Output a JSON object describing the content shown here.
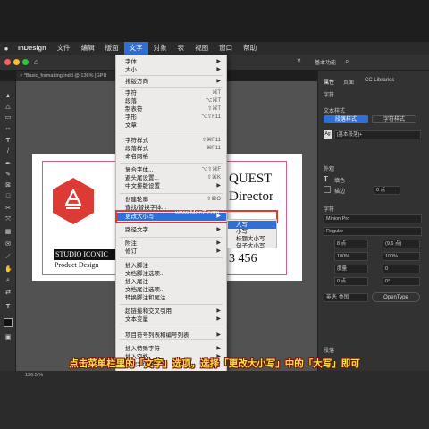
{
  "macbar": {
    "app_name": "InDesign",
    "menus": [
      "文件",
      "编辑",
      "版面",
      "文字",
      "对象",
      "表",
      "视图",
      "窗口",
      "帮助"
    ],
    "active_menu": "文字"
  },
  "doc_tab": "× *Basic_formatting.indd @ 136% [GPU",
  "workspace_label": "基本功能",
  "type_menu": {
    "items": [
      {
        "label": "字体",
        "shortcut": "",
        "submenu": true
      },
      {
        "label": "大小",
        "shortcut": "",
        "submenu": true
      },
      {
        "label": "排版方向",
        "shortcut": "",
        "submenu": true
      },
      {
        "label": "字符",
        "shortcut": "⌘T",
        "submenu": false
      },
      {
        "label": "段落",
        "shortcut": "⌥⌘T",
        "submenu": false
      },
      {
        "label": "制表符",
        "shortcut": "⇧⌘T",
        "submenu": false
      },
      {
        "label": "字形",
        "shortcut": "⌥⇧F11",
        "submenu": false
      },
      {
        "label": "文章",
        "shortcut": "",
        "submenu": false
      },
      {
        "label": "字符样式",
        "shortcut": "⇧⌘F11",
        "submenu": false
      },
      {
        "label": "段落样式",
        "shortcut": "⌘F11",
        "submenu": false
      },
      {
        "label": "命名网格",
        "shortcut": "",
        "submenu": false
      },
      {
        "label": "复合字体...",
        "shortcut": "⌥⇧⌘F",
        "submenu": false
      },
      {
        "label": "避头尾设置...",
        "shortcut": "⇧⌘K",
        "submenu": false
      },
      {
        "label": "中文排版设置",
        "shortcut": "",
        "submenu": true
      },
      {
        "label": "创建轮廓",
        "shortcut": "⇧⌘O",
        "submenu": false
      },
      {
        "label": "查找/替换字体...",
        "shortcut": "",
        "submenu": false
      },
      {
        "label": "更改大小写",
        "shortcut": "",
        "submenu": true
      },
      {
        "label": "路径文字",
        "shortcut": "",
        "submenu": true
      },
      {
        "label": "附注",
        "shortcut": "",
        "submenu": true
      },
      {
        "label": "修订",
        "shortcut": "",
        "submenu": true
      },
      {
        "label": "插入脚注",
        "shortcut": "",
        "submenu": false
      },
      {
        "label": "文档脚注选项...",
        "shortcut": "",
        "submenu": false
      },
      {
        "label": "插入尾注",
        "shortcut": "",
        "submenu": false
      },
      {
        "label": "文档尾注选项...",
        "shortcut": "",
        "submenu": false
      },
      {
        "label": "转换脚注和尾注...",
        "shortcut": "",
        "submenu": false
      },
      {
        "label": "超链接和交叉引用",
        "shortcut": "",
        "submenu": true
      },
      {
        "label": "文本变量",
        "shortcut": "",
        "submenu": true
      },
      {
        "label": "项目符号列表和编号列表",
        "shortcut": "",
        "submenu": true
      },
      {
        "label": "插入特殊字符",
        "shortcut": "",
        "submenu": true
      },
      {
        "label": "插入空格",
        "shortcut": "",
        "submenu": true
      },
      {
        "label": "用假字填充",
        "shortcut": "",
        "submenu": false
      }
    ],
    "highlighted": "更改大小写"
  },
  "case_submenu": {
    "items": [
      "大写",
      "小写",
      "标题大小写",
      "句子大小写"
    ],
    "highlighted": "大写"
  },
  "document": {
    "brand": "STUDIO ICONIC",
    "tagline": "Product Design",
    "title_fragment": "QUEST",
    "role_fragment": "Director",
    "number_fragment": "3 456"
  },
  "right_panel": {
    "tabs": [
      "属性",
      "页面",
      "CC Libraries"
    ],
    "character_heading": "字符",
    "text_styles": "文本样式",
    "style_tabs": [
      "段落样式",
      "字符样式"
    ],
    "paragraph_style_value": "[基本段落]+",
    "appearance": "外观",
    "fill_label": "填色",
    "stroke_label": "描边",
    "stroke_value": "0 点",
    "character_section": "字符",
    "font_family": "Minion Pro",
    "font_style": "Regular",
    "font_size": "8 点",
    "leading": "(9.6 点)",
    "h_scale": "100%",
    "v_scale": "100%",
    "kerning": "度量",
    "tracking": "0",
    "baseline": "0 点",
    "skew": "0°",
    "language": "英语: 美国",
    "opentype_button": "OpenType",
    "paragraph_section": "段落"
  },
  "status_zoom": "136.5 %",
  "watermark": "www.MacZ.com",
  "caption": "点击菜单栏里的「文字」选项，选择「更改大小写」中的「大写」即可",
  "colors": {
    "accent": "#2f6fd6",
    "menu_bg": "#ecebea",
    "highlight_box": "#e03a2a",
    "caption": "#f6e04b",
    "logo_red": "#dc3b35"
  }
}
